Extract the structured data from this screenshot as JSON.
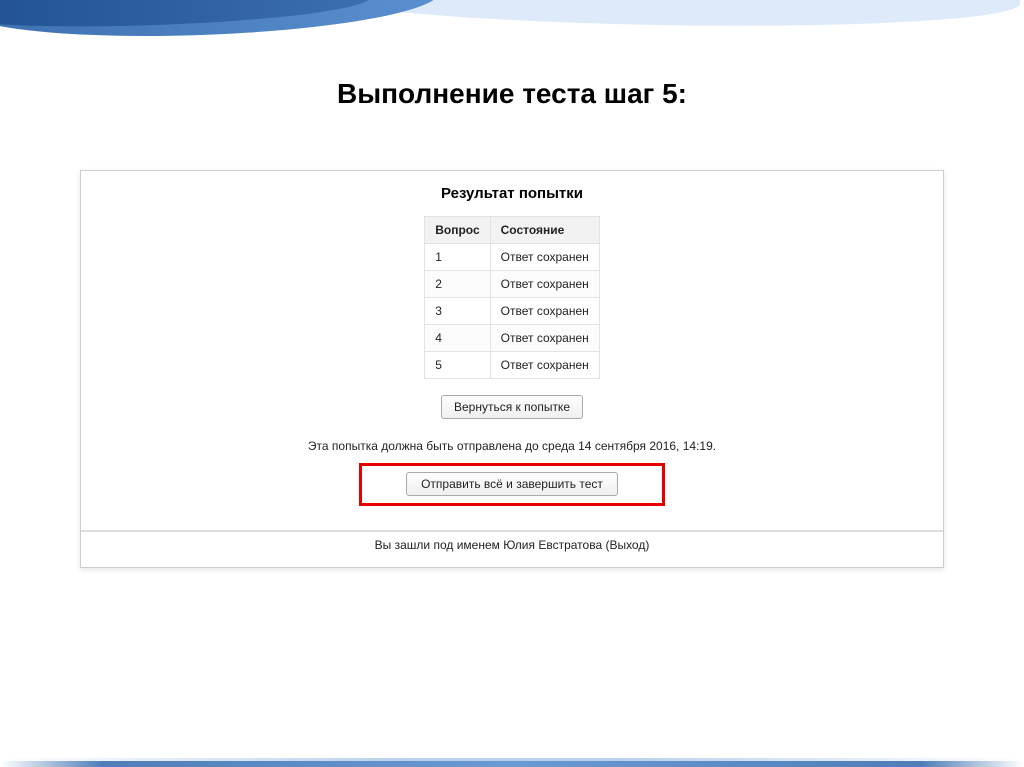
{
  "slide": {
    "title": "Выполнение  теста шаг 5:"
  },
  "content": {
    "heading": "Результат попытки",
    "table": {
      "col_question": "Вопрос",
      "col_state": "Состояние",
      "rows": [
        {
          "num": "1",
          "state": "Ответ сохранен"
        },
        {
          "num": "2",
          "state": "Ответ сохранен"
        },
        {
          "num": "3",
          "state": "Ответ сохранен"
        },
        {
          "num": "4",
          "state": "Ответ сохранен"
        },
        {
          "num": "5",
          "state": "Ответ сохранен"
        }
      ]
    },
    "return_button": "Вернуться к попытке",
    "deadline_text": "Эта попытка должна быть отправлена до среда 14 сентября 2016, 14:19.",
    "submit_button": "Отправить всё и завершить тест",
    "login_text": "Вы зашли под именем Юлия Евстратова (Выход)"
  }
}
